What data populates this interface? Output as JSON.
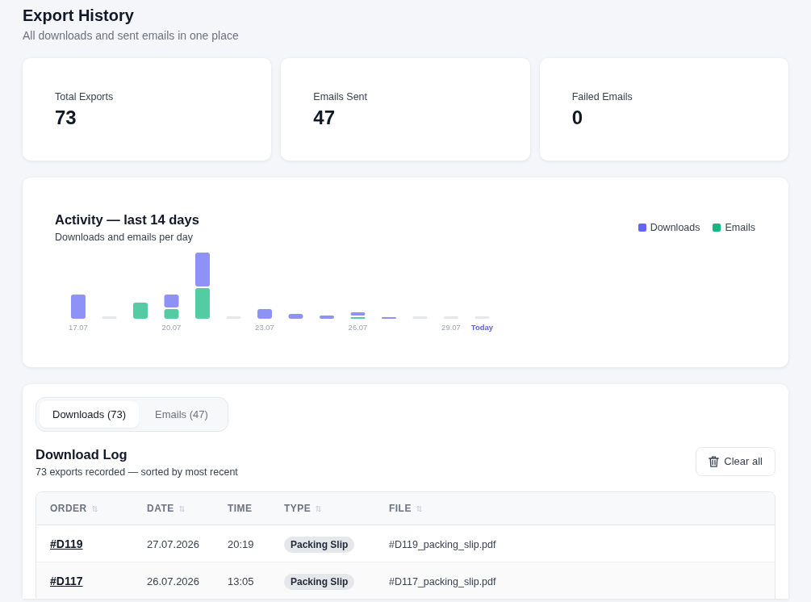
{
  "header": {
    "title": "Export History",
    "subtitle": "All downloads and sent emails in one place"
  },
  "stats": [
    {
      "label": "Total Exports",
      "value": "73"
    },
    {
      "label": "Emails Sent",
      "value": "47"
    },
    {
      "label": "Failed Emails",
      "value": "0"
    }
  ],
  "activity": {
    "title": "Activity — last 14 days",
    "subtitle": "Downloads and emails per day",
    "legend": [
      {
        "name": "Downloads",
        "color": "#6366f1"
      },
      {
        "name": "Emails",
        "color": "#10b981"
      }
    ],
    "day_labels": [
      "17.07",
      "20.07",
      "23.07",
      "26.07",
      "29.07",
      "Today"
    ],
    "last_label_highlighted": true
  },
  "log": {
    "tabs": [
      {
        "label": "Downloads (73)",
        "selected": true
      },
      {
        "label": "Emails (47)",
        "selected": false
      }
    ],
    "title": "Download Log",
    "subtitle": "73 exports recorded — sorted by most recent",
    "clear_button": "Clear all",
    "table": {
      "columns": [
        {
          "label": "ORDER",
          "sortable": true
        },
        {
          "label": "DATE",
          "sortable": true
        },
        {
          "label": "TIME",
          "sortable": false
        },
        {
          "label": "TYPE",
          "sortable": true
        },
        {
          "label": "FILE",
          "sortable": true
        }
      ],
      "rows": [
        {
          "order": "#D119",
          "date": "27.07.2026",
          "time": "20:19",
          "type": "Packing Slip",
          "file": "#D119_packing_slip.pdf"
        },
        {
          "order": "#D117",
          "date": "26.07.2026",
          "time": "13:05",
          "type": "Packing Slip",
          "file": "#D117_packing_slip.pdf"
        }
      ]
    }
  }
}
